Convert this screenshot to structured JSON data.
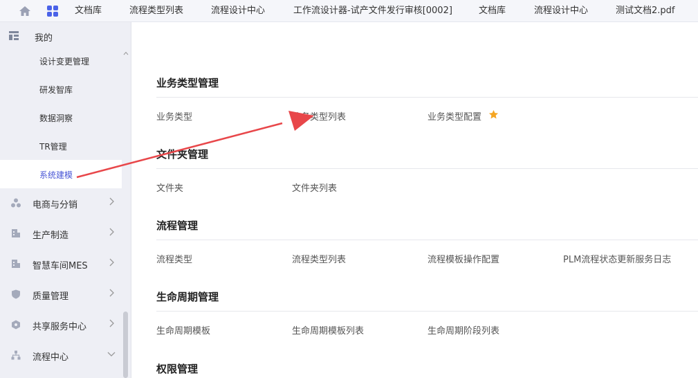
{
  "topbar": {
    "tabs": [
      "文档库",
      "流程类型列表",
      "流程设计中心",
      "工作流设计器-试产文件发行审核[0002]",
      "文档库",
      "流程设计中心",
      "测试文档2.pdf"
    ],
    "icons": [
      "home-icon",
      "apps-grid-icon"
    ],
    "accent": "#4a62e8"
  },
  "sidebar": {
    "header": "我的",
    "sub_items": [
      "设计变更管理",
      "研发智库",
      "数据洞察",
      "TR管理",
      "系统建模"
    ],
    "active_sub": "系统建模",
    "groups": [
      {
        "label": "电商与分销",
        "icon": "share-nodes-icon"
      },
      {
        "label": "生产制造",
        "icon": "factory-icon"
      },
      {
        "label": "智慧车间MES",
        "icon": "factory-icon"
      },
      {
        "label": "质量管理",
        "icon": "shield-icon"
      },
      {
        "label": "共享服务中心",
        "icon": "cube-icon"
      },
      {
        "label": "流程中心",
        "icon": "org-chart-icon"
      }
    ],
    "active_color": "#4a57d6"
  },
  "main": {
    "sections": [
      {
        "title": "业务类型管理",
        "links": [
          "业务类型",
          "业务类型列表",
          "业务类型配置"
        ]
      },
      {
        "title": "文件夹管理",
        "links": [
          "文件夹",
          "文件夹列表"
        ]
      },
      {
        "title": "流程管理",
        "links": [
          "流程类型",
          "流程类型列表",
          "流程模板操作配置",
          "PLM流程状态更新服务日志"
        ]
      },
      {
        "title": "生命周期管理",
        "links": [
          "生命周期模板",
          "生命周期模板列表",
          "生命周期阶段列表"
        ]
      },
      {
        "title": "权限管理",
        "links": []
      }
    ],
    "favorite_star_color": "#f5a623",
    "annotation_arrow_color": "#e8474a"
  }
}
